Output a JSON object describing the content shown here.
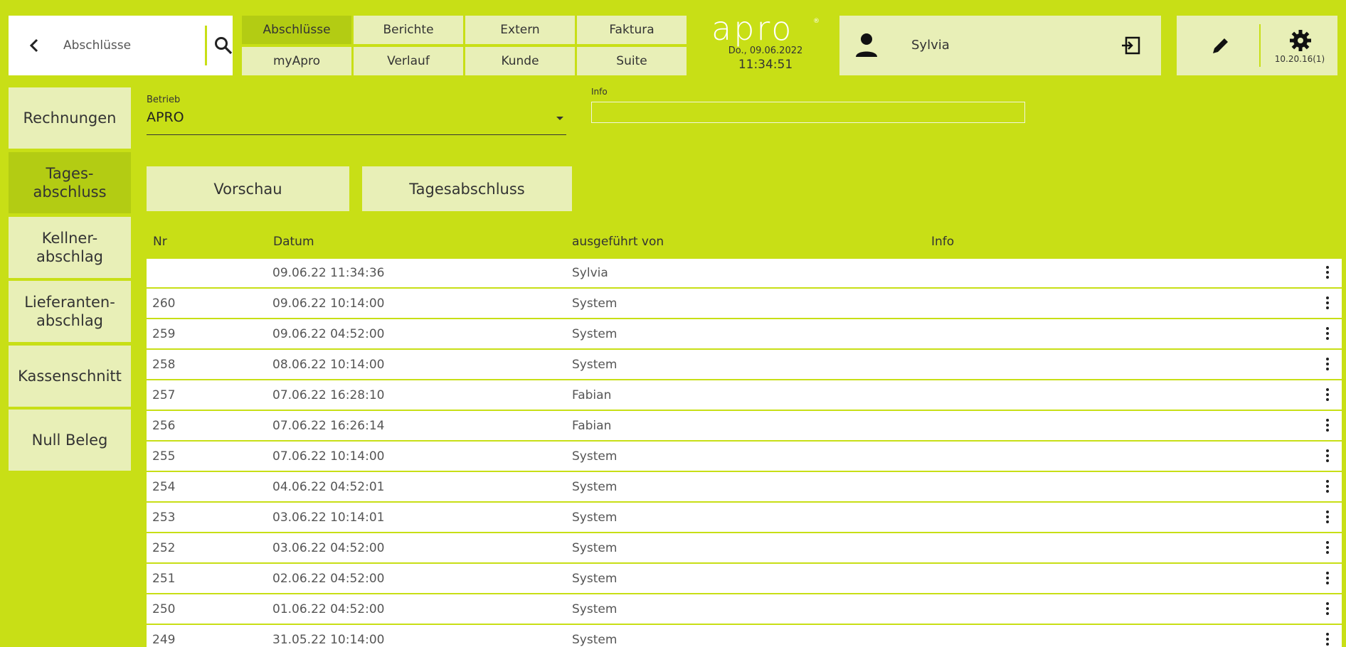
{
  "header": {
    "search_label": "Abschlüsse",
    "menu": [
      {
        "label": "Abschlüsse",
        "active": true
      },
      {
        "label": "Berichte",
        "active": false
      },
      {
        "label": "Extern",
        "active": false
      },
      {
        "label": "Faktura",
        "active": false
      },
      {
        "label": "myApro",
        "active": false
      },
      {
        "label": "Verlauf",
        "active": false
      },
      {
        "label": "Kunde",
        "active": false
      },
      {
        "label": "Suite",
        "active": false
      }
    ],
    "logo_text": "apro",
    "date": "Do., 09.06.2022",
    "time": "11:34:51",
    "user": "Sylvia",
    "version": "10.20.16(1)"
  },
  "sidebar": {
    "items": [
      {
        "label": "Rechnungen",
        "active": false
      },
      {
        "label": "Tages-\nabschluss",
        "active": true
      },
      {
        "label": "Kellner-\nabschlag",
        "active": false
      },
      {
        "label": "Lieferanten-\nabschlag",
        "active": false
      },
      {
        "label": "Kassenschnitt",
        "active": false
      },
      {
        "label": "Null Beleg",
        "active": false
      }
    ]
  },
  "form": {
    "betrieb_label": "Betrieb",
    "betrieb_value": "APRO",
    "info_label": "Info",
    "info_value": ""
  },
  "actions": {
    "preview_label": "Vorschau",
    "close_label": "Tagesabschluss"
  },
  "table": {
    "columns": [
      "Nr",
      "Datum",
      "ausgeführt von",
      "Info"
    ],
    "rows": [
      {
        "nr": "",
        "datum": "09.06.22 11:34:36",
        "von": "Sylvia",
        "info": ""
      },
      {
        "nr": "260",
        "datum": "09.06.22 10:14:00",
        "von": "System",
        "info": ""
      },
      {
        "nr": "259",
        "datum": "09.06.22 04:52:00",
        "von": "System",
        "info": ""
      },
      {
        "nr": "258",
        "datum": "08.06.22 10:14:00",
        "von": "System",
        "info": ""
      },
      {
        "nr": "257",
        "datum": "07.06.22 16:28:10",
        "von": "Fabian",
        "info": ""
      },
      {
        "nr": "256",
        "datum": "07.06.22 16:26:14",
        "von": "Fabian",
        "info": ""
      },
      {
        "nr": "255",
        "datum": "07.06.22 10:14:00",
        "von": "System",
        "info": ""
      },
      {
        "nr": "254",
        "datum": "04.06.22 04:52:01",
        "von": "System",
        "info": ""
      },
      {
        "nr": "253",
        "datum": "03.06.22 10:14:01",
        "von": "System",
        "info": ""
      },
      {
        "nr": "252",
        "datum": "03.06.22 04:52:00",
        "von": "System",
        "info": ""
      },
      {
        "nr": "251",
        "datum": "02.06.22 04:52:00",
        "von": "System",
        "info": ""
      },
      {
        "nr": "250",
        "datum": "01.06.22 04:52:00",
        "von": "System",
        "info": ""
      },
      {
        "nr": "249",
        "datum": "31.05.22 10:14:00",
        "von": "System",
        "info": ""
      }
    ]
  },
  "colors": {
    "background": "#c8df16",
    "panel": "#e8efb7",
    "active": "#b3cc13",
    "row": "#ffffff"
  },
  "icons": [
    "back-arrow-icon",
    "search-icon",
    "user-icon",
    "logout-icon",
    "edit-pencil-icon",
    "gear-icon",
    "more-vert-icon"
  ]
}
